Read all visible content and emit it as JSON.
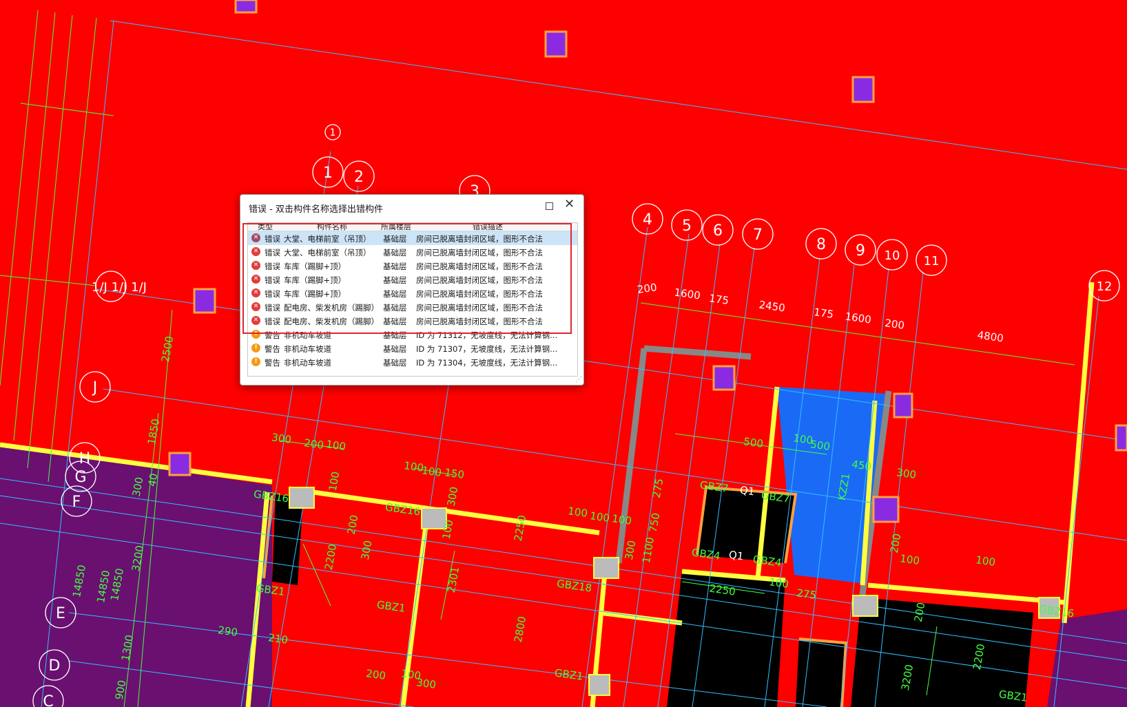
{
  "drawing": {
    "axis_numbers": [
      "1",
      "1",
      "2",
      "3",
      "4",
      "5",
      "6",
      "7",
      "8",
      "9",
      "10",
      "11",
      "12"
    ],
    "axis_letters": [
      "J",
      "H",
      "G",
      "F",
      "E",
      "D",
      "C"
    ],
    "axis_text_1j": "1/J 1/J 1/J",
    "dims": [
      "200",
      "1600",
      "175",
      "2450",
      "175",
      "1600",
      "200",
      "4800",
      "2500",
      "1850",
      "300",
      "200",
      "100",
      "100",
      "200",
      "300",
      "100",
      "100",
      "150",
      "300",
      "100",
      "2250",
      "100",
      "100",
      "100",
      "500",
      "100",
      "500",
      "450",
      "300",
      "200",
      "100",
      "2200",
      "2301",
      "2800",
      "3200",
      "1300",
      "900",
      "14850",
      "14850",
      "14850",
      "300",
      "40",
      "290",
      "210",
      "200",
      "300",
      "100",
      "275",
      "2250",
      "100",
      "275",
      "750",
      "1100",
      "300",
      "100",
      "200",
      "2200",
      "3200"
    ],
    "labels": [
      "GBZ16",
      "GBZ16",
      "GBZ1",
      "GBZ1",
      "GBZ18",
      "GBZ1",
      "GBZ7",
      "Q1",
      "GBZ7",
      "GBZ4",
      "Q1",
      "GBZ4",
      "KZZ1",
      "GBZ16",
      "GBZ1"
    ]
  },
  "dialog": {
    "title": "错误 - 双击构件名称选择出错构件",
    "columns": [
      "类型",
      "构件名称",
      "所属楼层",
      "错误描述"
    ],
    "rows": [
      {
        "icon": "error-selected-icon",
        "type": "错误",
        "name": "大堂、电梯前室（吊顶）",
        "floor": "基础层",
        "desc": "房间已脱离墙封闭区域，图形不合法"
      },
      {
        "icon": "error-icon",
        "type": "错误",
        "name": "大堂、电梯前室（吊顶）",
        "floor": "基础层",
        "desc": "房间已脱离墙封闭区域，图形不合法"
      },
      {
        "icon": "error-icon",
        "type": "错误",
        "name": "车库（踢脚+顶）",
        "floor": "基础层",
        "desc": "房间已脱离墙封闭区域，图形不合法"
      },
      {
        "icon": "error-icon",
        "type": "错误",
        "name": "车库（踢脚+顶）",
        "floor": "基础层",
        "desc": "房间已脱离墙封闭区域，图形不合法"
      },
      {
        "icon": "error-icon",
        "type": "错误",
        "name": "车库（踢脚+顶）",
        "floor": "基础层",
        "desc": "房间已脱离墙封闭区域，图形不合法"
      },
      {
        "icon": "error-icon",
        "type": "错误",
        "name": "配电房、柴发机房（踢脚）",
        "floor": "基础层",
        "desc": "房间已脱离墙封闭区域，图形不合法"
      },
      {
        "icon": "error-icon",
        "type": "错误",
        "name": "配电房、柴发机房（踢脚）",
        "floor": "基础层",
        "desc": "房间已脱离墙封闭区域，图形不合法"
      },
      {
        "icon": "warning-icon",
        "type": "警告",
        "name": "非机动车坡道",
        "floor": "基础层",
        "desc": "ID 为 71312，无坡度线，无法计算钢..."
      },
      {
        "icon": "warning-icon",
        "type": "警告",
        "name": "非机动车坡道",
        "floor": "基础层",
        "desc": "ID 为 71307，无坡度线，无法计算钢..."
      },
      {
        "icon": "warning-icon",
        "type": "警告",
        "name": "非机动车坡道",
        "floor": "基础层",
        "desc": "ID 为 71304，无坡度线，无法计算钢..."
      }
    ]
  },
  "colors": {
    "background": "#ff0000",
    "purple_zone": "#6a1070",
    "blue_room": "#1a6af5",
    "wall_gray": "#888888",
    "beam_yellow": "#ffff40",
    "grid_line": "#30c0ff",
    "dim_green": "#40ff40",
    "column_fill": "#8a2be2",
    "highlight": "#e0242a"
  }
}
